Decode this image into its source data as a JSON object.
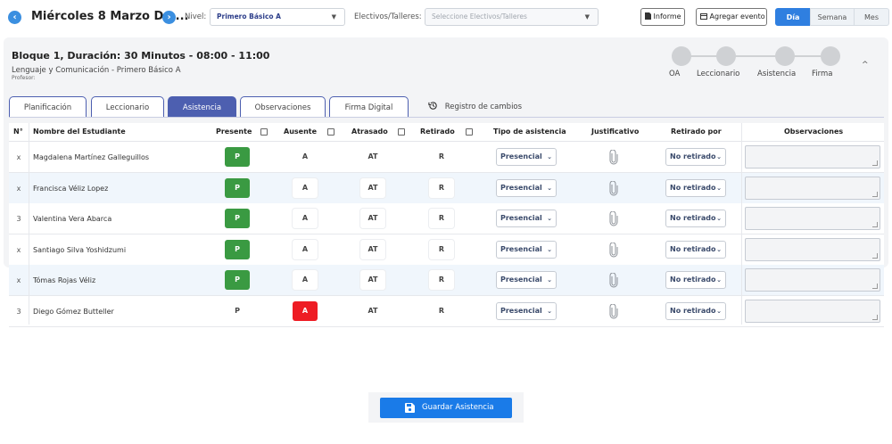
{
  "header": {
    "date_title": "Miércoles 8 Marzo De ...",
    "nivel_label": "Nivel:",
    "nivel_value": "Primero Básico A",
    "electivos_label": "Electivos/Talleres:",
    "electivos_placeholder": "Seleccione Electivos/Talleres",
    "informe_label": "Informe",
    "agregar_evento_label": "Agregar evento",
    "views": [
      "Día",
      "Semana",
      "Mes"
    ],
    "active_view": "Día"
  },
  "bloque": {
    "title": "Bloque 1, Duración: 30 Minutos - 08:00 - 11:00",
    "subtitle": "Lenguaje y Comunicación - Primero Básico A",
    "profesor_label": "Profesor:",
    "steps": [
      "OA",
      "Leccionario",
      "Asistencia",
      "Firma"
    ]
  },
  "tabs": {
    "items": [
      "Planificación",
      "Leccionario",
      "Asistencia",
      "Observaciones",
      "Firma Digital"
    ],
    "active": "Asistencia",
    "history_label": "Registro de cambios"
  },
  "table": {
    "columns": {
      "num": "N°",
      "name": "Nombre del Estudiante",
      "presente": "Presente",
      "ausente": "Ausente",
      "atrasado": "Atrasado",
      "retirado": "Retirado",
      "tipo": "Tipo de asistencia",
      "justificativo": "Justificativo",
      "retirado_por": "Retirado por",
      "observaciones": "Observaciones"
    },
    "rows": [
      {
        "num": "x",
        "name": "Magdalena Martínez Galleguillos",
        "p": "P",
        "a": "A",
        "at": "AT",
        "r": "R",
        "status": "presente",
        "tipo": "Presencial",
        "retirado_por": "No retirado"
      },
      {
        "num": "x",
        "name": "Francisca Véliz Lopez",
        "p": "P",
        "a": "A",
        "at": "AT",
        "r": "R",
        "status": "presente",
        "tipo": "Presencial",
        "retirado_por": "No retirado"
      },
      {
        "num": "3",
        "name": "Valentina Vera Abarca",
        "p": "P",
        "a": "A",
        "at": "AT",
        "r": "R",
        "status": "presente",
        "tipo": "Presencial",
        "retirado_por": "No retirado"
      },
      {
        "num": "x",
        "name": "Santiago Silva Yoshidzumi",
        "p": "P",
        "a": "A",
        "at": "AT",
        "r": "R",
        "status": "presente",
        "tipo": "Presencial",
        "retirado_por": "No retirado"
      },
      {
        "num": "x",
        "name": "Tómas Rojas Véliz",
        "p": "P",
        "a": "A",
        "at": "AT",
        "r": "R",
        "status": "presente",
        "tipo": "Presencial",
        "retirado_por": "No retirado"
      },
      {
        "num": "3",
        "name": "Diego Gómez Butteller",
        "p": "P",
        "a": "A",
        "at": "AT",
        "r": "R",
        "status": "ausente",
        "tipo": "Presencial",
        "retirado_por": "No retirado"
      }
    ]
  },
  "save_label": "Guardar Asistencia",
  "colors": {
    "present": "#3a9a42",
    "absent": "#ee1c24",
    "accent": "#4d5fb0",
    "primary": "#1a7be8"
  }
}
